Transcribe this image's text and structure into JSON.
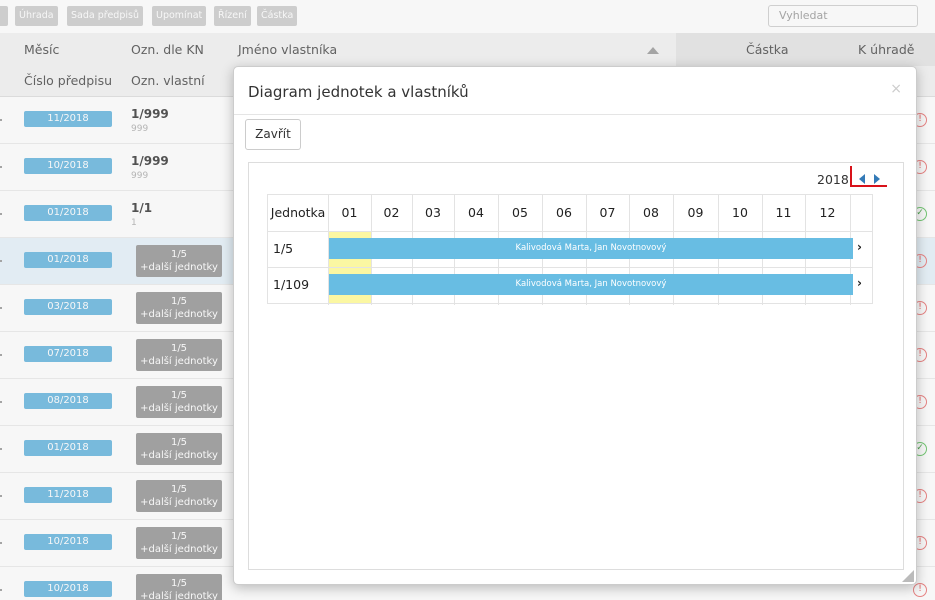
{
  "toolbar": {
    "buttons": [
      "Úhrada",
      "Sada předpisů",
      "Upomínat",
      "Řízení",
      "Částka"
    ],
    "search_placeholder": "Vyhledat"
  },
  "table": {
    "headers_top": [
      "Měsíc",
      "Ozn. dle KN",
      "Jméno vlastníka",
      "Částka",
      "K úhradě"
    ],
    "headers_bottom": [
      "Číslo předpisu",
      "Ozn. vlastní"
    ],
    "rows": [
      {
        "month": "11/2018",
        "kn": "1/999",
        "kn_sub": "999",
        "status": "!"
      },
      {
        "month": "10/2018",
        "kn": "1/999",
        "kn_sub": "999",
        "status": "!"
      },
      {
        "month": "01/2018",
        "kn": "1/1",
        "kn_sub": "1",
        "status": "✓"
      },
      {
        "month": "01/2018",
        "unit": "1/5",
        "unit_more": "+další jednotky",
        "status": "!"
      },
      {
        "month": "03/2018",
        "unit": "1/5",
        "unit_more": "+další jednotky",
        "status": "!"
      },
      {
        "month": "07/2018",
        "unit": "1/5",
        "unit_more": "+další jednotky",
        "status": "!"
      },
      {
        "month": "08/2018",
        "unit": "1/5",
        "unit_more": "+další jednotky",
        "status": "!"
      },
      {
        "month": "01/2018",
        "unit": "1/5",
        "unit_more": "+další jednotky",
        "status": "✓"
      },
      {
        "month": "11/2018",
        "unit": "1/5",
        "unit_more": "+další jednotky",
        "status": "!"
      },
      {
        "month": "10/2018",
        "unit": "1/5",
        "unit_more": "+další jednotky",
        "status": "!"
      },
      {
        "month": "10/2018",
        "unit": "1/5",
        "unit_more": "+další jednotky",
        "status": "!"
      }
    ]
  },
  "modal": {
    "title": "Diagram jednotek a vlastníků",
    "close_icon": "×",
    "close_button": "Zavřít",
    "year": "2018",
    "grid": {
      "header": "Jednotka",
      "months": [
        "01",
        "02",
        "03",
        "04",
        "05",
        "06",
        "07",
        "08",
        "09",
        "10",
        "11",
        "12"
      ],
      "rows": [
        {
          "unit": "1/5",
          "owners": "Kalivodová Marta, Jan Novotnovový"
        },
        {
          "unit": "1/109",
          "owners": "Kalivodová Marta, Jan Novotnovový"
        }
      ]
    }
  }
}
